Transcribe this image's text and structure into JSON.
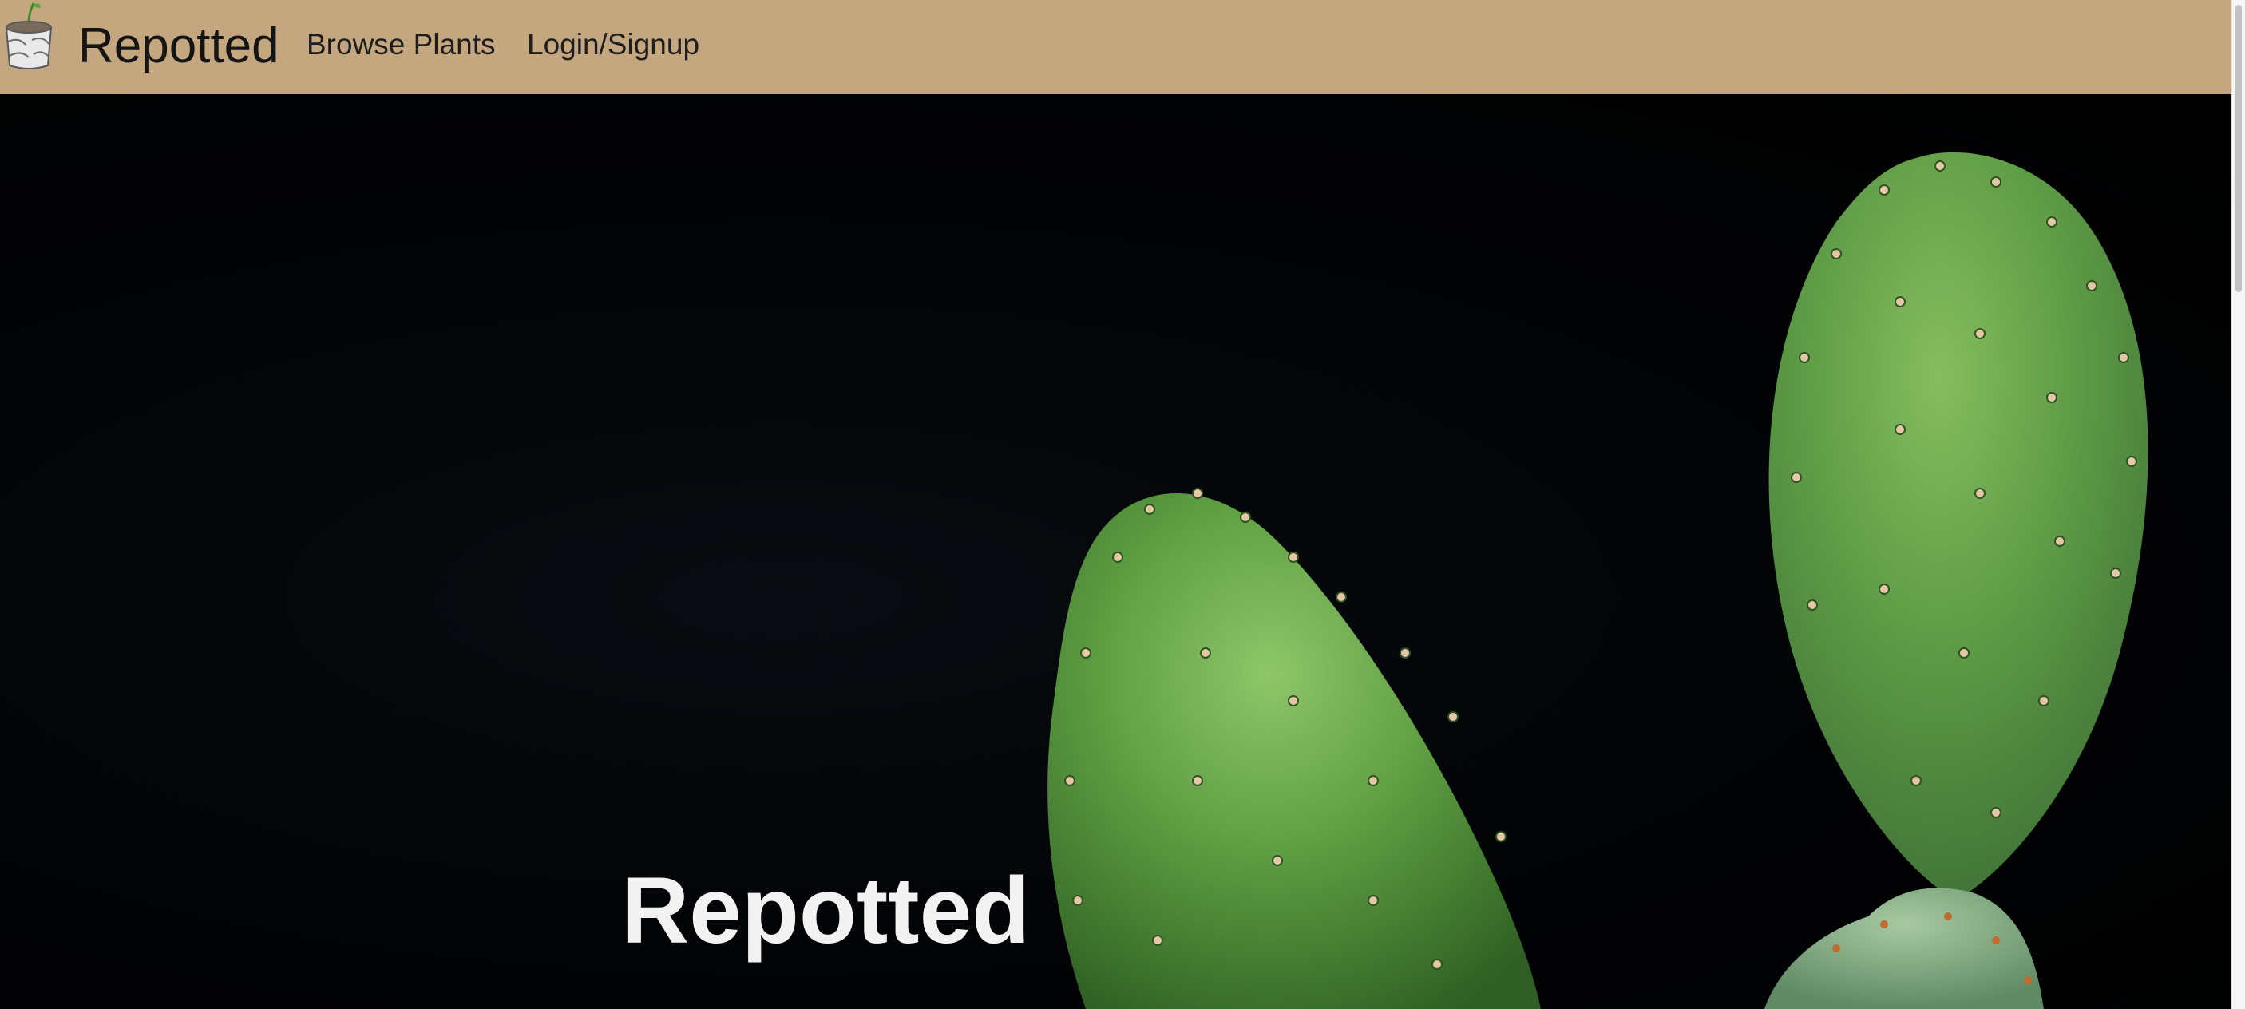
{
  "navbar": {
    "brand": "Repotted",
    "logo_icon": "potted-plant-icon",
    "links": [
      {
        "label": "Browse Plants"
      },
      {
        "label": "Login/Signup"
      }
    ],
    "background_color": "#c4a77f"
  },
  "hero": {
    "title": "Repotted",
    "image": "prickly-pear-cactus-on-black",
    "title_color": "#f2f2f2"
  }
}
